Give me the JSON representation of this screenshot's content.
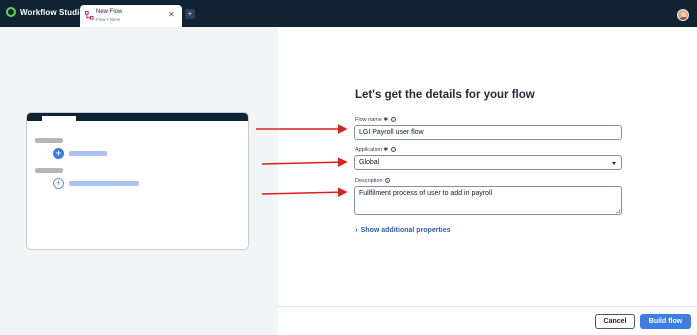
{
  "app": {
    "name": "Workflow Studio"
  },
  "tab": {
    "title": "New Flow",
    "subtitle": "Flow • None",
    "close_icon": "close-icon"
  },
  "add_tab": {
    "label": "+"
  },
  "form": {
    "heading": "Let's get the details for your flow",
    "flow_name": {
      "label": "Flow name",
      "required_marker": "✱",
      "value": "LGI Payroll user flow"
    },
    "application": {
      "label": "Application",
      "required_marker": "✱",
      "selected": "Global"
    },
    "description": {
      "label": "Description",
      "value": "Fullfilment process of user to add in payroll"
    },
    "more_properties": "Show additional properties"
  },
  "footer": {
    "cancel_label": "Cancel",
    "build_label": "Build flow"
  },
  "colors": {
    "topbar": "#0f2332",
    "brand_green": "#62d84e",
    "primary_blue": "#3f7de0",
    "link_blue": "#2f5fb3",
    "arrow_red": "#d9221c"
  },
  "icons": {
    "info": "i",
    "plus": "+"
  }
}
